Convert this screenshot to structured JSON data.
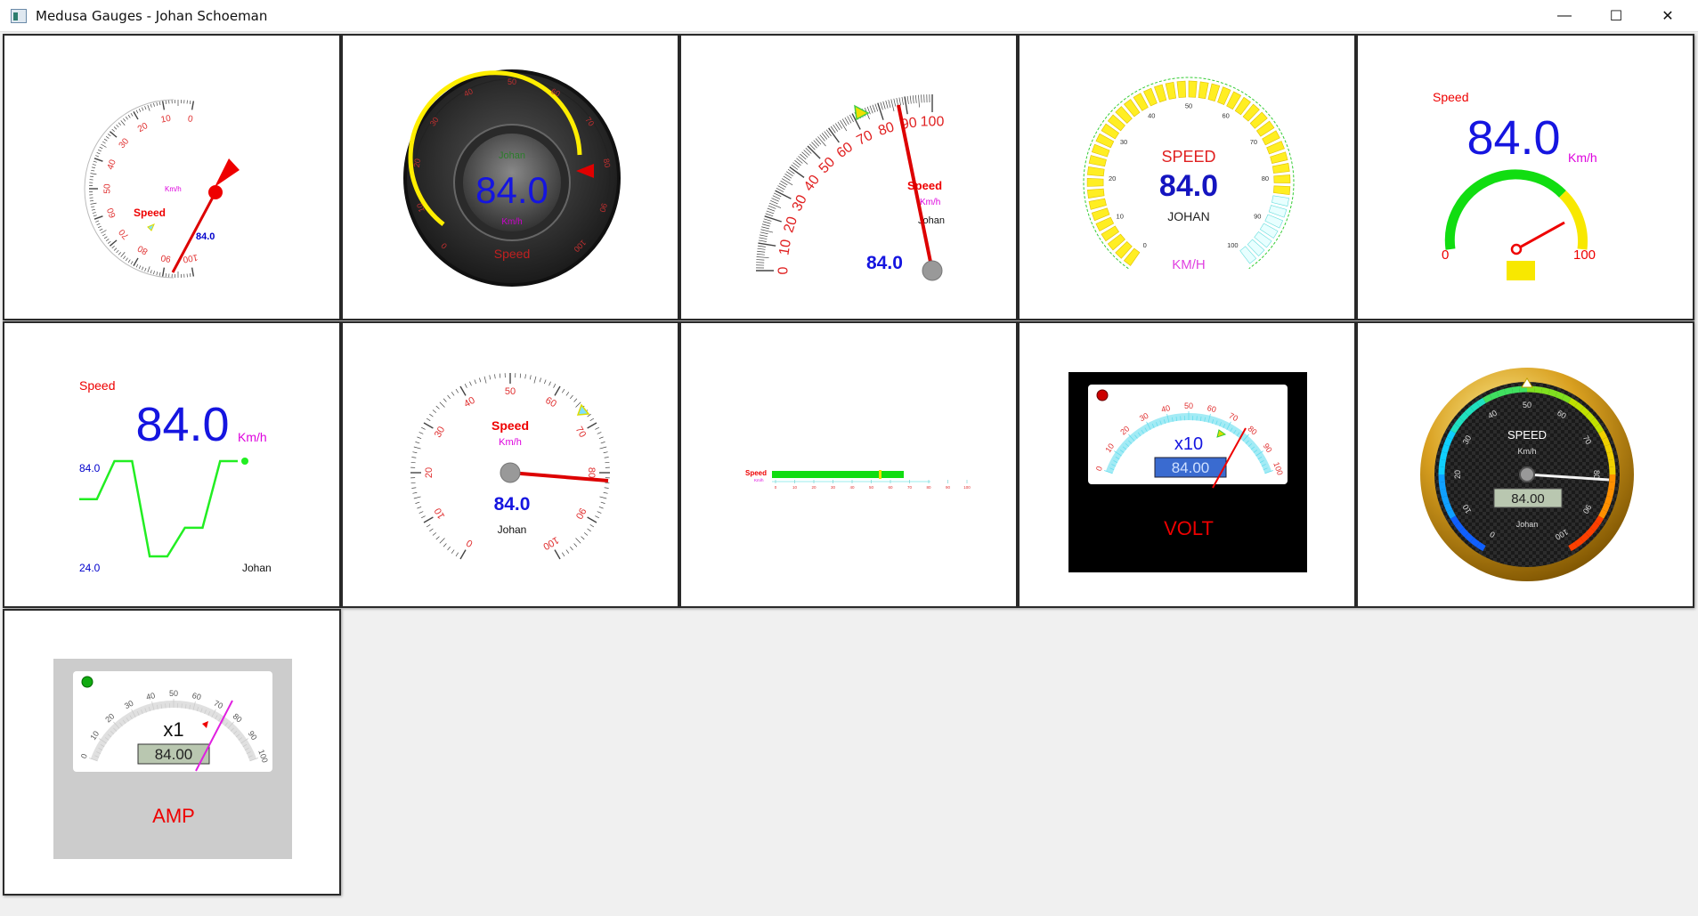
{
  "window": {
    "title": "Medusa Gauges - Johan Schoeman",
    "minimize_glyph": "—",
    "maximize_glyph": "☐",
    "close_glyph": "✕"
  },
  "gauges": {
    "value": 84.0,
    "value_text": "84.0",
    "lcd_text": "84.00",
    "title": "Speed",
    "unit": "Km/h",
    "subtitle": "Johan",
    "g1_ticks": [
      "0",
      "10",
      "20",
      "30",
      "40",
      "50",
      "60",
      "70",
      "80",
      "90",
      "100"
    ],
    "g4": {
      "title": "SPEED",
      "lcd": "84.0",
      "subtitle": "JOHAN",
      "unit": "KM/H"
    },
    "g5": {
      "min": "0",
      "max": "100"
    },
    "g6": {
      "max_label": "84.0",
      "min_label": "24.0",
      "history": [
        60,
        60,
        84,
        84,
        24,
        24,
        42,
        42,
        84,
        84
      ]
    },
    "g9": {
      "scale": "x10",
      "title": "VOLT"
    },
    "g10": {
      "title": "SPEED",
      "unit": "Km/h",
      "subtitle": "Johan"
    },
    "g11": {
      "scale": "x1",
      "title": "AMP"
    }
  }
}
